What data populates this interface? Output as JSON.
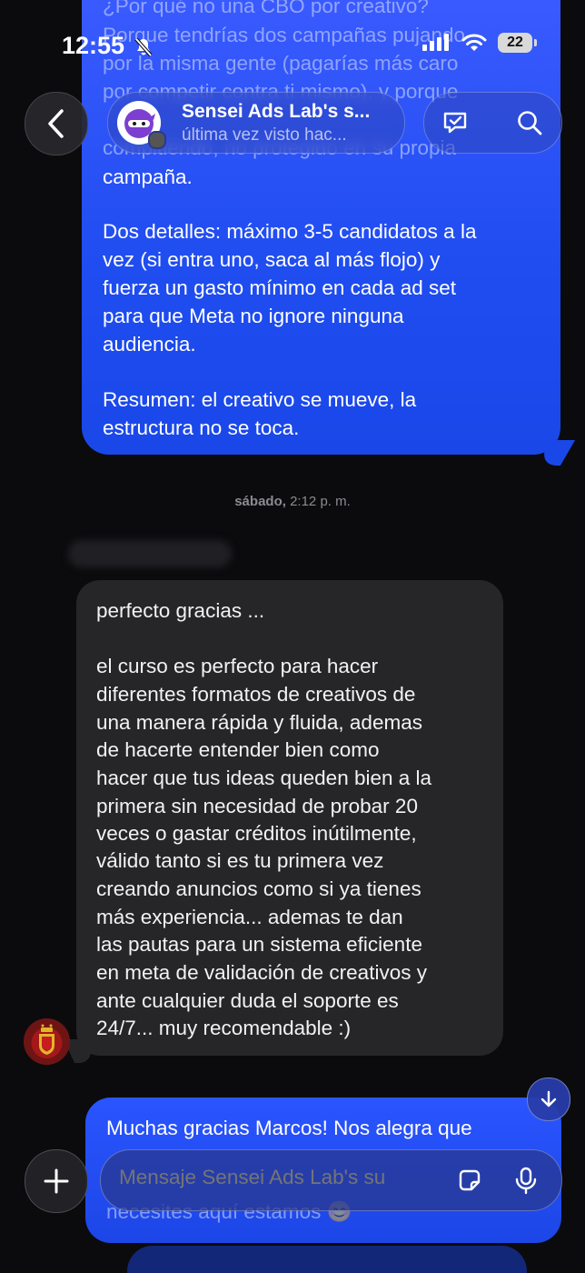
{
  "status_bar": {
    "time": "12:55",
    "battery": "22"
  },
  "header": {
    "chat_name": "Sensei Ads Lab's s...",
    "last_seen": "última vez visto hac..."
  },
  "messages": {
    "outgoing_top": {
      "faded_lines": [
        "¿Por qué no una CBO por creativo?",
        "Porque tendrías dos campañas pujando",
        "por la misma gente (pagarías más caro",
        "por competir contra ti mismo), y porque"
      ],
      "lines": [
        "compitiendo, no protegido en su propia",
        "campaña."
      ],
      "paragraph2": [
        "Dos detalles: máximo 3-5 candidatos a la",
        "vez (si entra uno, saca al más flojo) y",
        "fuerza un gasto mínimo en cada ad set",
        "para que Meta no ignore ninguna",
        "audiencia."
      ],
      "paragraph3": [
        "Resumen: el creativo se mueve, la",
        "estructura no se toca."
      ]
    },
    "date_separator": {
      "day": "sábado,",
      "time": "2:12 p. m."
    },
    "incoming": {
      "lines": [
        "perfecto gracias ...",
        "",
        "el curso es perfecto para hacer",
        "diferentes formatos de creativos de",
        "una manera rápida y fluida, ademas",
        "de hacerte entender bien como",
        "hacer que tus ideas queden bien a la",
        "primera sin necesidad de probar 20",
        "veces o gastar créditos inútilmente,",
        "válido tanto si es tu primera vez",
        "creando anuncios como si ya tienes",
        "más experiencia...  ademas te dan",
        "las pautas para un sistema eficiente",
        "en meta de validación de creativos y",
        "ante cualquier duda el soporte es",
        "24/7... muy recomendable :)"
      ]
    },
    "outgoing_bottom": {
      "line1": "Muchas gracias Marcos! Nos alegra que",
      "line3": "necesites aquí estamos 😊"
    }
  },
  "composer": {
    "placeholder": "Mensaje Sensei Ads Lab's su"
  },
  "icons": {
    "back": "chevron-left-icon",
    "report": "shield-check-icon",
    "search": "search-icon",
    "scroll_down": "arrow-down-icon",
    "add": "plus-icon",
    "sticker": "sticker-icon",
    "mic": "microphone-icon"
  },
  "colors": {
    "outgoing_bubble": "#1f4df0",
    "incoming_bubble": "#262628",
    "background": "#0b0b0d"
  }
}
